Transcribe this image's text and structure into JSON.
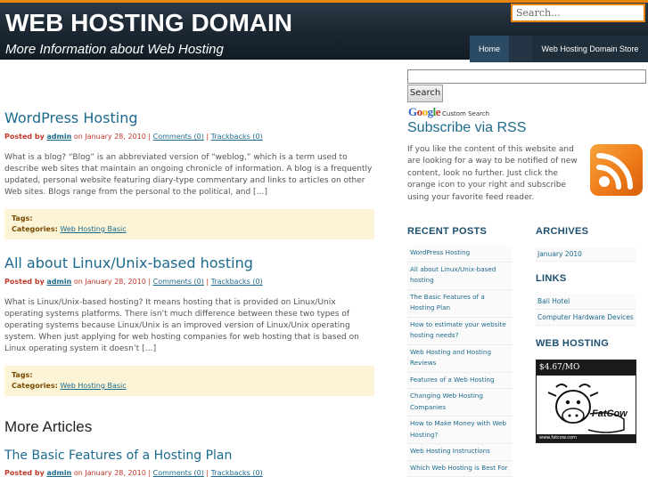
{
  "header": {
    "site_title": "WEB HOSTING DOMAIN",
    "tagline": "More Information about Web Hosting",
    "search_placeholder": "Search...",
    "nav": [
      "Home",
      "",
      "Web Hosting Domain Store"
    ]
  },
  "posts": [
    {
      "title": "WordPress Hosting",
      "posted_by": "Posted by",
      "author": "admin",
      "date": "on January 28, 2010 |",
      "comments": "Comments (0)",
      "sep": "|",
      "trackbacks": "Trackbacks (0)",
      "excerpt": "What is a blog? “Blog” is an abbreviated version of “weblog,” which is a term used to describe web sites that maintain an ongoing chronicle of information. A blog is a frequently updated, personal website featuring diary-type commentary and links to articles on other Web sites. Blogs range from the personal to the political, and […]",
      "tags_label": "Tags:",
      "categories_label": "Categories:",
      "category": "Web Hosting Basic"
    },
    {
      "title": "All about Linux/Unix-based hosting",
      "posted_by": "Posted by",
      "author": "admin",
      "date": "on January 28, 2010 |",
      "comments": "Comments (0)",
      "sep": "|",
      "trackbacks": "Trackbacks (0)",
      "excerpt": "What is Linux/Unix-based hosting? It means hosting that is provided on Linux/Unix operating systems platforms. There isn’t much difference between these two types of operating systems because Linux/Unix is an improved version of Linux/Unix operating system. When just applying for web hosting companies for web hosting that is based on Linux operating system it doesn’t […]",
      "tags_label": "Tags:",
      "categories_label": "Categories:",
      "category": "Web Hosting Basic"
    }
  ],
  "more_articles": {
    "heading": "More Articles",
    "post": {
      "title": "The Basic Features of a Hosting Plan",
      "posted_by": "Posted by",
      "author": "admin",
      "date": "on January 28, 2010 |",
      "comments": "Comments (0)",
      "sep": "|",
      "trackbacks": "Trackbacks (0)"
    }
  },
  "sidebar": {
    "search_button": "Search",
    "google_text": "Google",
    "custom_search": "Custom Search",
    "rss_title": "Subscribe via RSS",
    "rss_text": "If you like the content of this website and are looking for a way to be notified of new content, look no further. Just click the orange icon to your right and subscribe using your favorite feed reader.",
    "recent_posts_title": "RECENT POSTS",
    "recent_posts": [
      "WordPress Hosting",
      "All about Linux/Unix-based hosting",
      "The Basic Features of a Hosting Plan",
      "How to estimate your website hosting needs?",
      "Web Hosting and Hosting Reviews",
      "Features of a Web Hosting",
      "Changing Web Hosting Companies",
      "How to Make Money with Web Hosting?",
      "Web Hosting Instructions",
      "Which Web Hosting is Best For"
    ],
    "archives_title": "ARCHIVES",
    "archives": [
      "January 2010"
    ],
    "links_title": "LINKS",
    "links": [
      "Bali Hotel",
      "Computer Hardware Devices"
    ],
    "web_hosting_title": "WEB HOSTING",
    "ad": {
      "price": "$4.67/MO",
      "brand": "FatCow",
      "url": "www.fatcow.com"
    }
  },
  "colors": {
    "accent_orange": "#e8850e",
    "link_blue": "#1c6a8d",
    "meta_red": "#c0392b",
    "tag_bg": "#fcf4d6"
  }
}
